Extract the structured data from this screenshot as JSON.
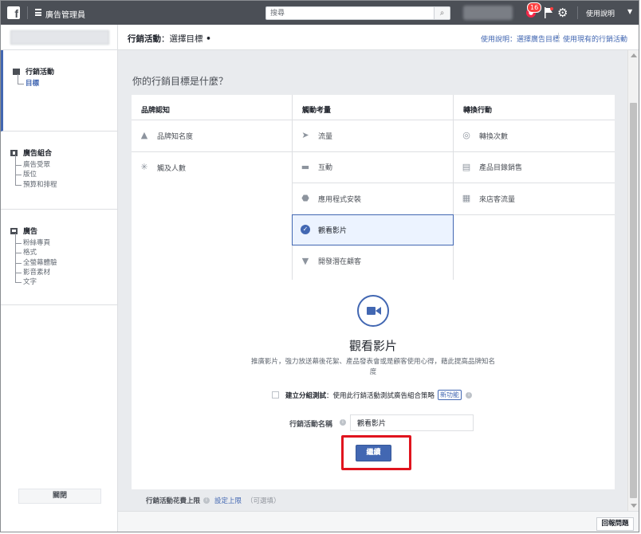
{
  "topbar": {
    "logo": "f",
    "app_title": "廣告管理員",
    "search_placeholder": "搜尋",
    "search_icon": "search-icon",
    "notifications_count": "16",
    "help_label": "使用說明"
  },
  "sidebar": {
    "campaign": {
      "title": "行銷活動",
      "items": [
        "目標"
      ]
    },
    "adset": {
      "title": "廣告組合",
      "items": [
        "廣告受眾",
        "版位",
        "預算和排程"
      ]
    },
    "ad": {
      "title": "廣告",
      "items": [
        "粉絲專頁",
        "格式",
        "全螢幕體驗",
        "影音素材",
        "文字"
      ]
    },
    "close_label": "關閉"
  },
  "header": {
    "title": "行銷活動",
    "subtitle": "：選擇目標",
    "dot": "•",
    "link_help": "使用說明：選擇廣告目標",
    "link_existing": "使用現有的行銷活動"
  },
  "question": "你的行銷目標是什麼？",
  "objectives": {
    "columns": [
      {
        "header": "品牌認知",
        "items": [
          {
            "label": "品牌知名度",
            "icon": "megaphone-icon"
          },
          {
            "label": "觸及人數",
            "icon": "reach-icon"
          }
        ]
      },
      {
        "header": "觸動考量",
        "items": [
          {
            "label": "流量",
            "icon": "cursor-icon"
          },
          {
            "label": "互動",
            "icon": "chat-icon"
          },
          {
            "label": "應用程式安裝",
            "icon": "box-icon"
          },
          {
            "label": "觀看影片",
            "icon": "check-icon",
            "selected": true
          },
          {
            "label": "開發潛在顧客",
            "icon": "funnel-icon"
          }
        ]
      },
      {
        "header": "轉換行動",
        "items": [
          {
            "label": "轉換次數",
            "icon": "globe-icon"
          },
          {
            "label": "產品目錄銷售",
            "icon": "cart-icon"
          },
          {
            "label": "來店客流量",
            "icon": "store-icon"
          }
        ]
      }
    ]
  },
  "details": {
    "title": "觀看影片",
    "description": "推廣影片，強力放送幕後花絮、產品發表會或是顧客使用心得，藉此提高品牌知名度",
    "split_test_label": "建立分組測試",
    "split_test_text": "：使用此行銷活動測試廣告組合策略",
    "new_badge": "新功能",
    "name_label": "行銷活動名稱",
    "name_value": "觀看影片",
    "continue_label": "繼續"
  },
  "spend": {
    "label": "行銷活動花費上限",
    "set_limit": "設定上限",
    "optional": "（可選填）"
  },
  "report_label": "回報問題"
}
